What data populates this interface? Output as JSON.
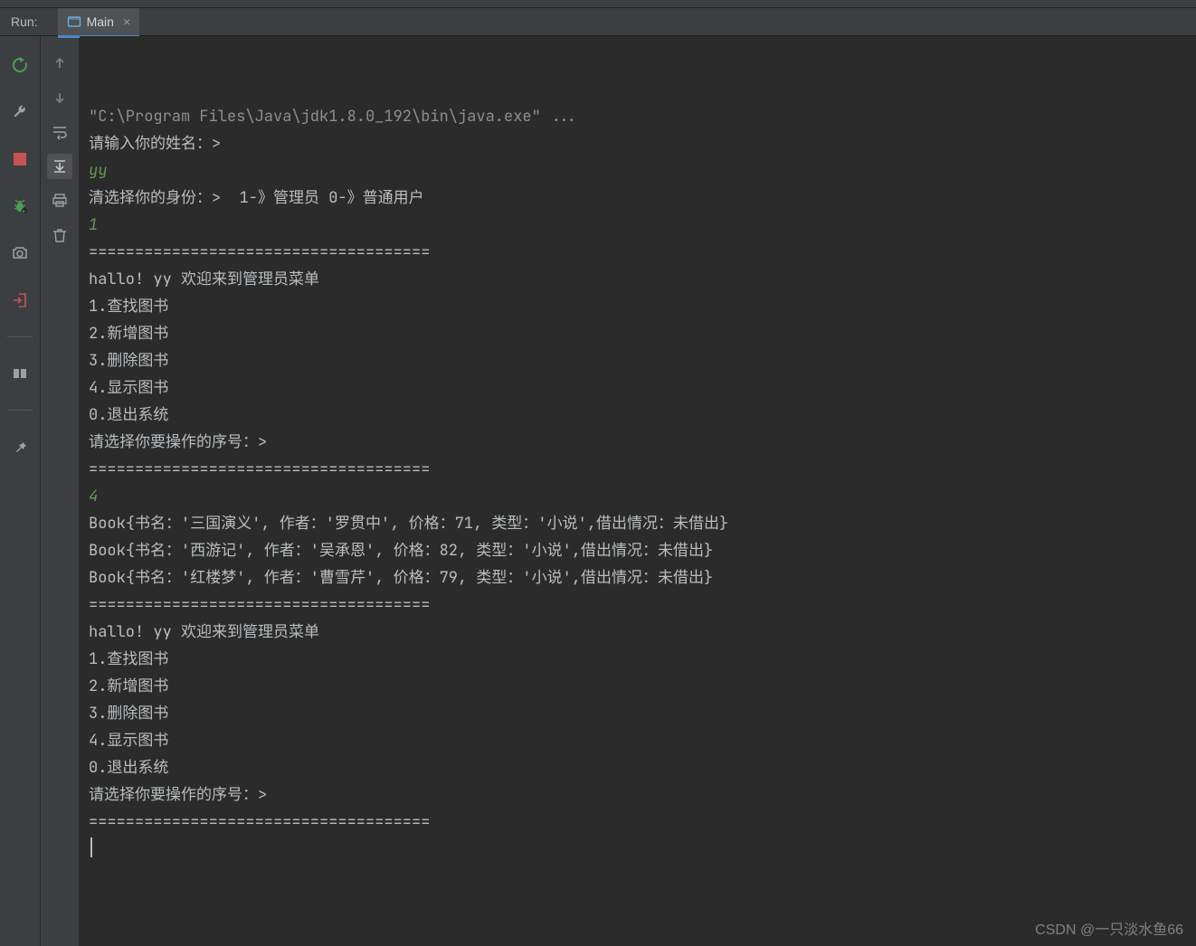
{
  "header": {
    "run_label": "Run:",
    "tab": {
      "label": "Main",
      "close": "×"
    }
  },
  "console": {
    "lines": [
      {
        "cls": "c-cmd",
        "text": "\"C:\\Program Files\\Java\\jdk1.8.0_192\\bin\\java.exe\" ..."
      },
      {
        "cls": "c-out",
        "text": "请输入你的姓名：> "
      },
      {
        "cls": "c-in",
        "text": "yy"
      },
      {
        "cls": "c-out",
        "text": "清选择你的身份：>  1-》管理员 0-》普通用户"
      },
      {
        "cls": "c-in",
        "text": "1"
      },
      {
        "cls": "c-out",
        "text": "====================================="
      },
      {
        "cls": "c-out",
        "text": "hallo! yy 欢迎来到管理员菜单"
      },
      {
        "cls": "c-out",
        "text": "1.查找图书"
      },
      {
        "cls": "c-out",
        "text": "2.新增图书"
      },
      {
        "cls": "c-out",
        "text": "3.删除图书"
      },
      {
        "cls": "c-out",
        "text": "4.显示图书"
      },
      {
        "cls": "c-out",
        "text": "0.退出系统"
      },
      {
        "cls": "c-out",
        "text": "请选择你要操作的序号：> "
      },
      {
        "cls": "c-out",
        "text": "====================================="
      },
      {
        "cls": "c-in",
        "text": "4"
      },
      {
        "cls": "c-out",
        "text": "Book{书名：'三国演义', 作者：'罗贯中', 价格：71, 类型：'小说',借出情况：未借出}"
      },
      {
        "cls": "c-out",
        "text": "Book{书名：'西游记', 作者：'吴承恩', 价格：82, 类型：'小说',借出情况：未借出}"
      },
      {
        "cls": "c-out",
        "text": "Book{书名：'红楼梦', 作者：'曹雪芹', 价格：79, 类型：'小说',借出情况：未借出}"
      },
      {
        "cls": "c-out",
        "text": "====================================="
      },
      {
        "cls": "c-out",
        "text": "hallo! yy 欢迎来到管理员菜单"
      },
      {
        "cls": "c-out",
        "text": "1.查找图书"
      },
      {
        "cls": "c-out",
        "text": "2.新增图书"
      },
      {
        "cls": "c-out",
        "text": "3.删除图书"
      },
      {
        "cls": "c-out",
        "text": "4.显示图书"
      },
      {
        "cls": "c-out",
        "text": "0.退出系统"
      },
      {
        "cls": "c-out",
        "text": "请选择你要操作的序号：> "
      },
      {
        "cls": "c-out",
        "text": "====================================="
      }
    ]
  },
  "watermark": "CSDN @一只淡水鱼66",
  "colors": {
    "accent": "#4a88c7",
    "input_green": "#5f9e52",
    "stop_red": "#c75450",
    "bug_green": "#499c54"
  }
}
